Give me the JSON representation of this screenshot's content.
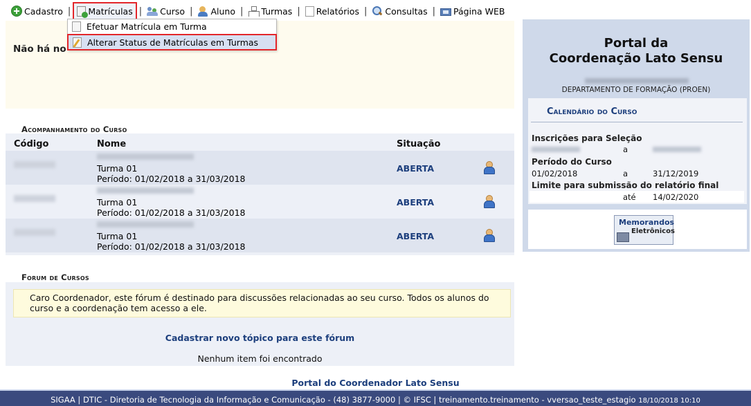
{
  "menu": {
    "items": [
      {
        "label": "Cadastro",
        "icon": "add-circle-icon"
      },
      {
        "label": "Matrículas",
        "icon": "document-add-icon"
      },
      {
        "label": "Curso",
        "icon": "people-icon"
      },
      {
        "label": "Aluno",
        "icon": "student-icon"
      },
      {
        "label": "Turmas",
        "icon": "org-tree-icon"
      },
      {
        "label": "Relatórios",
        "icon": "page-icon"
      },
      {
        "label": "Consultas",
        "icon": "search-icon"
      },
      {
        "label": "Página WEB",
        "icon": "web-page-icon"
      }
    ]
  },
  "dropdown": {
    "items": [
      {
        "label": "Efetuar Matrícula em Turma"
      },
      {
        "label": "Alterar Status de Matrículas em Turmas"
      }
    ]
  },
  "notice": {
    "text": "Não há no"
  },
  "courses": {
    "section_title": "Acompanhamento do Curso",
    "headers": {
      "code": "Código",
      "name": "Nome",
      "status": "Situação"
    },
    "rows": [
      {
        "turma": "Turma 01",
        "periodo": "Período: 01/02/2018 a 31/03/2018",
        "situacao": "ABERTA"
      },
      {
        "turma": "Turma 01",
        "periodo": "Período: 01/02/2018 a 31/03/2018",
        "situacao": "ABERTA"
      },
      {
        "turma": "Turma 01",
        "periodo": "Período: 01/02/2018 a 31/03/2018",
        "situacao": "ABERTA"
      }
    ]
  },
  "forum": {
    "section_title": "Forum de Cursos",
    "message": "Caro Coordenador, este fórum é destinado para discussões relacionadas ao seu curso. Todos os alunos do curso e a coordenação tem acesso a ele.",
    "new_topic_link": "Cadastrar novo tópico para este fórum",
    "empty_text": "Nenhum item foi encontrado"
  },
  "portal_link": "Portal do Coordenador Lato Sensu",
  "sidebar": {
    "title_line1": "Portal da",
    "title_line2": "Coordenação Lato Sensu",
    "department": "DEPARTAMENTO DE FORMAÇÃO (PROEN)",
    "calendar": {
      "title": "Calendário do Curso",
      "inscricoes_label": "Inscrições para Seleção",
      "sep_a": "a",
      "periodo_label": "Período do Curso",
      "periodo_start": "01/02/2018",
      "periodo_end": "31/12/2019",
      "limite_label": "Limite para submissão do relatório final",
      "limite_sep": "até",
      "limite_date": "14/02/2020"
    },
    "memo": {
      "line1": "Memorandos",
      "line2": "Eletrônicos"
    }
  },
  "footer": {
    "text": "SIGAA | DTIC - Diretoria de Tecnologia da Informação e Comunicação - (48) 3877-9000 | © IFSC | treinamento.treinamento - vversao_teste_estagio",
    "timestamp": "18/10/2018 10:10"
  },
  "colors": {
    "link": "#1d3f7d",
    "footer_bg": "#3a4a7e",
    "highlight_border": "#e3262a",
    "sidebar_bg": "#cfd9ea"
  }
}
